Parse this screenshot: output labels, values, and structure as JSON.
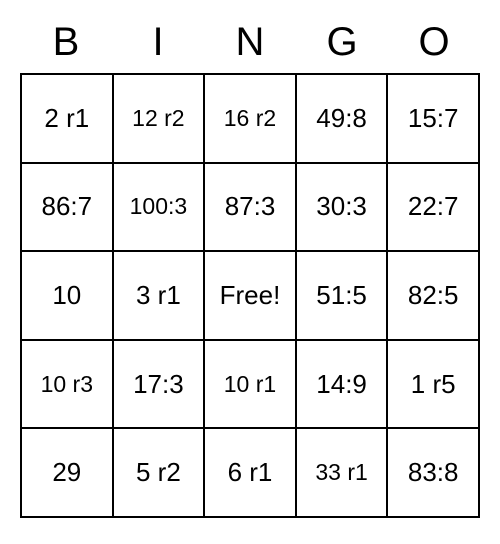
{
  "headers": [
    "B",
    "I",
    "N",
    "G",
    "O"
  ],
  "cells": [
    [
      "2 r1",
      "12 r2",
      "16 r2",
      "49:8",
      "15:7"
    ],
    [
      "86:7",
      "100:3",
      "87:3",
      "30:3",
      "22:7"
    ],
    [
      "10",
      "3 r1",
      "Free!",
      "51:5",
      "82:5"
    ],
    [
      "10 r3",
      "17:3",
      "10 r1",
      "14:9",
      "1 r5"
    ],
    [
      "29",
      "5 r2",
      "6 r1",
      "33 r1",
      "83:8"
    ]
  ]
}
